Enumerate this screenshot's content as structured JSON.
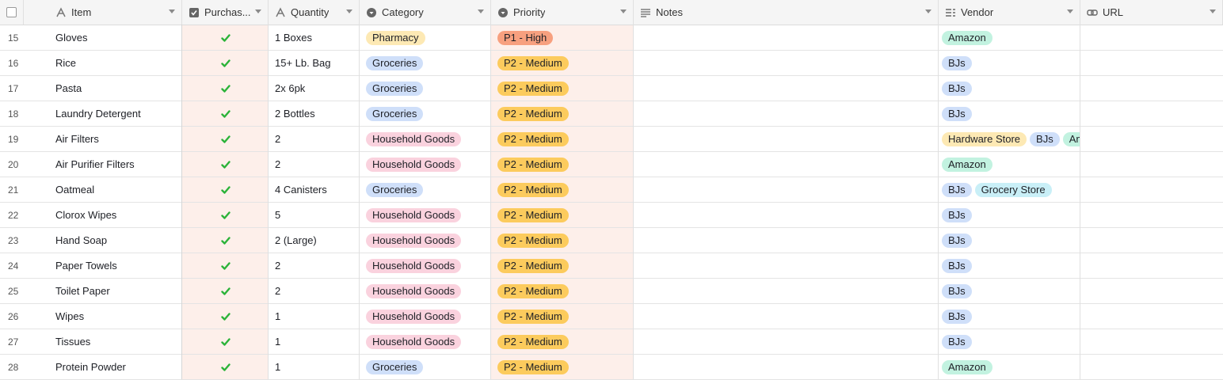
{
  "header": {
    "columns": [
      {
        "key": "item",
        "label": "Item",
        "icon": "text-icon"
      },
      {
        "key": "purchased",
        "label": "Purchas...",
        "icon": "checkbox-icon"
      },
      {
        "key": "quantity",
        "label": "Quantity",
        "icon": "text-icon"
      },
      {
        "key": "category",
        "label": "Category",
        "icon": "single-select-icon"
      },
      {
        "key": "priority",
        "label": "Priority",
        "icon": "single-select-icon"
      },
      {
        "key": "notes",
        "label": "Notes",
        "icon": "long-text-icon"
      },
      {
        "key": "vendor",
        "label": "Vendor",
        "icon": "multi-select-icon"
      },
      {
        "key": "url",
        "label": "URL",
        "icon": "link-icon"
      }
    ]
  },
  "colors": {
    "pharmacy": "#fde9b4",
    "groceries": "#cfdff9",
    "household": "#fad2de",
    "high": "#f7a07f",
    "medium": "#fccb5d",
    "amazon": "#c2f2e0",
    "bjs": "#cfdff9",
    "hardware": "#fde9b4",
    "grocery_store": "#c9eff7",
    "highlight": "#fdefea",
    "check": "#2bb339"
  },
  "rows": [
    {
      "num": "15",
      "item": "Gloves",
      "purchased": true,
      "quantity": "1 Boxes",
      "category": "Pharmacy",
      "priority": "P1 - High",
      "notes": "",
      "vendor": [
        "Amazon"
      ],
      "url": ""
    },
    {
      "num": "16",
      "item": "Rice",
      "purchased": true,
      "quantity": "15+ Lb. Bag",
      "category": "Groceries",
      "priority": "P2 - Medium",
      "notes": "",
      "vendor": [
        "BJs"
      ],
      "url": ""
    },
    {
      "num": "17",
      "item": "Pasta",
      "purchased": true,
      "quantity": "2x 6pk",
      "category": "Groceries",
      "priority": "P2 - Medium",
      "notes": "",
      "vendor": [
        "BJs"
      ],
      "url": ""
    },
    {
      "num": "18",
      "item": "Laundry Detergent",
      "purchased": true,
      "quantity": "2 Bottles",
      "category": "Groceries",
      "priority": "P2 - Medium",
      "notes": "",
      "vendor": [
        "BJs"
      ],
      "url": ""
    },
    {
      "num": "19",
      "item": "Air Filters",
      "purchased": true,
      "quantity": "2",
      "category": "Household Goods",
      "priority": "P2 - Medium",
      "notes": "",
      "vendor": [
        "Hardware Store",
        "BJs",
        "Amazon"
      ],
      "url": ""
    },
    {
      "num": "20",
      "item": "Air Purifier Filters",
      "purchased": true,
      "quantity": "2",
      "category": "Household Goods",
      "priority": "P2 - Medium",
      "notes": "",
      "vendor": [
        "Amazon"
      ],
      "url": ""
    },
    {
      "num": "21",
      "item": "Oatmeal",
      "purchased": true,
      "quantity": "4 Canisters",
      "category": "Groceries",
      "priority": "P2 - Medium",
      "notes": "",
      "vendor": [
        "BJs",
        "Grocery Store"
      ],
      "url": ""
    },
    {
      "num": "22",
      "item": "Clorox Wipes",
      "purchased": true,
      "quantity": "5",
      "category": "Household Goods",
      "priority": "P2 - Medium",
      "notes": "",
      "vendor": [
        "BJs"
      ],
      "url": ""
    },
    {
      "num": "23",
      "item": "Hand Soap",
      "purchased": true,
      "quantity": "2 (Large)",
      "category": "Household Goods",
      "priority": "P2 - Medium",
      "notes": "",
      "vendor": [
        "BJs"
      ],
      "url": ""
    },
    {
      "num": "24",
      "item": "Paper Towels",
      "purchased": true,
      "quantity": "2",
      "category": "Household Goods",
      "priority": "P2 - Medium",
      "notes": "",
      "vendor": [
        "BJs"
      ],
      "url": ""
    },
    {
      "num": "25",
      "item": "Toilet Paper",
      "purchased": true,
      "quantity": "2",
      "category": "Household Goods",
      "priority": "P2 - Medium",
      "notes": "",
      "vendor": [
        "BJs"
      ],
      "url": ""
    },
    {
      "num": "26",
      "item": "Wipes",
      "purchased": true,
      "quantity": "1",
      "category": "Household Goods",
      "priority": "P2 - Medium",
      "notes": "",
      "vendor": [
        "BJs"
      ],
      "url": ""
    },
    {
      "num": "27",
      "item": "Tissues",
      "purchased": true,
      "quantity": "1",
      "category": "Household Goods",
      "priority": "P2 - Medium",
      "notes": "",
      "vendor": [
        "BJs"
      ],
      "url": ""
    },
    {
      "num": "28",
      "item": "Protein Powder",
      "purchased": true,
      "quantity": "1",
      "category": "Groceries",
      "priority": "P2 - Medium",
      "notes": "",
      "vendor": [
        "Amazon"
      ],
      "url": ""
    }
  ]
}
